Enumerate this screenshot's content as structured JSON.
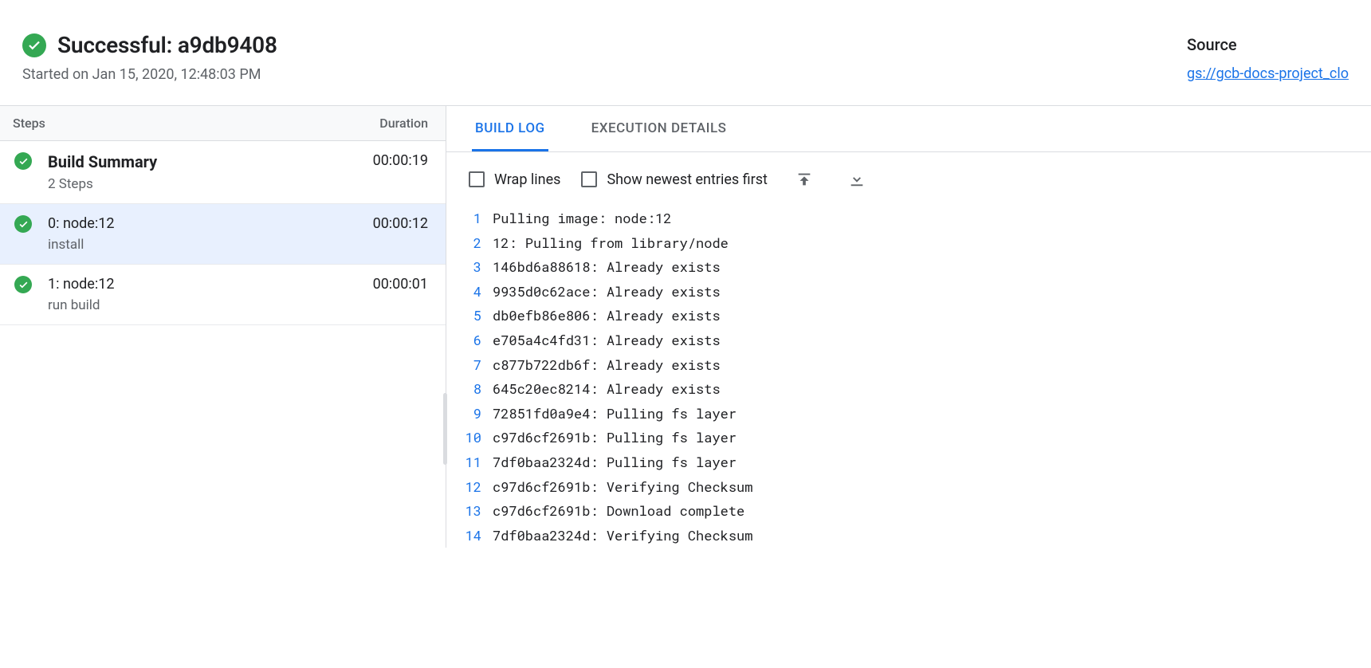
{
  "header": {
    "title": "Successful: a9db9408",
    "subtitle": "Started on Jan 15, 2020, 12:48:03 PM",
    "source_label": "Source",
    "source_link": "gs://gcb-docs-project_clo"
  },
  "steps_header": {
    "left": "Steps",
    "right": "Duration"
  },
  "summary": {
    "title": "Build Summary",
    "subtitle": "2 Steps",
    "duration": "00:00:19"
  },
  "steps": [
    {
      "title": "0: node:12",
      "subtitle": "install",
      "duration": "00:00:12",
      "selected": true
    },
    {
      "title": "1: node:12",
      "subtitle": "run build",
      "duration": "00:00:01",
      "selected": false
    }
  ],
  "tabs": {
    "build_log": "BUILD LOG",
    "execution_details": "EXECUTION DETAILS"
  },
  "toolbar": {
    "wrap": "Wrap lines",
    "newest_first": "Show newest entries first"
  },
  "log": [
    "Pulling image: node:12",
    "12: Pulling from library/node",
    "146bd6a88618: Already exists",
    "9935d0c62ace: Already exists",
    "db0efb86e806: Already exists",
    "e705a4c4fd31: Already exists",
    "c877b722db6f: Already exists",
    "645c20ec8214: Already exists",
    "72851fd0a9e4: Pulling fs layer",
    "c97d6cf2691b: Pulling fs layer",
    "7df0baa2324d: Pulling fs layer",
    "c97d6cf2691b: Verifying Checksum",
    "c97d6cf2691b: Download complete",
    "7df0baa2324d: Verifying Checksum"
  ]
}
